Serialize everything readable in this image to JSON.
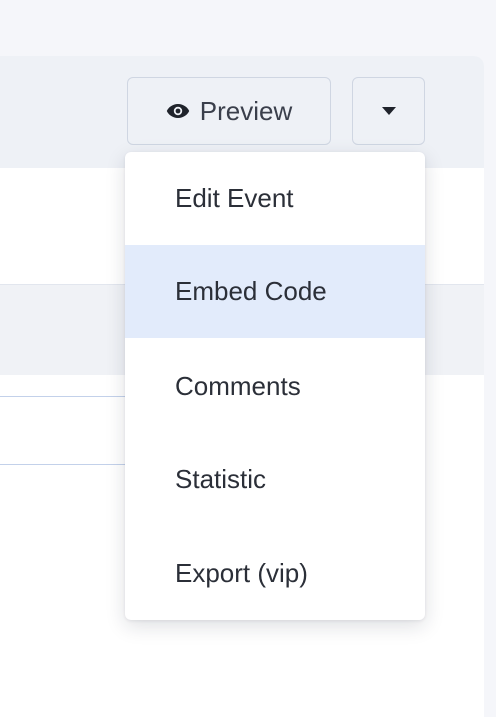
{
  "toolbar": {
    "preview_label": "Preview",
    "preview_icon": "eye-icon",
    "caret_icon": "caret-down-icon"
  },
  "dropdown_menu": {
    "items": [
      {
        "label": "Edit Event",
        "active": false
      },
      {
        "label": "Embed Code",
        "active": true
      },
      {
        "label": "Comments",
        "active": false
      },
      {
        "label": "Statistic",
        "active": false
      },
      {
        "label": "Export (vip)",
        "active": false
      }
    ]
  },
  "colors": {
    "page_background": "#f5f6fa",
    "header_background": "#eef1f6",
    "active_item_background": "#e2ebfb",
    "text": "#2b2f38"
  }
}
